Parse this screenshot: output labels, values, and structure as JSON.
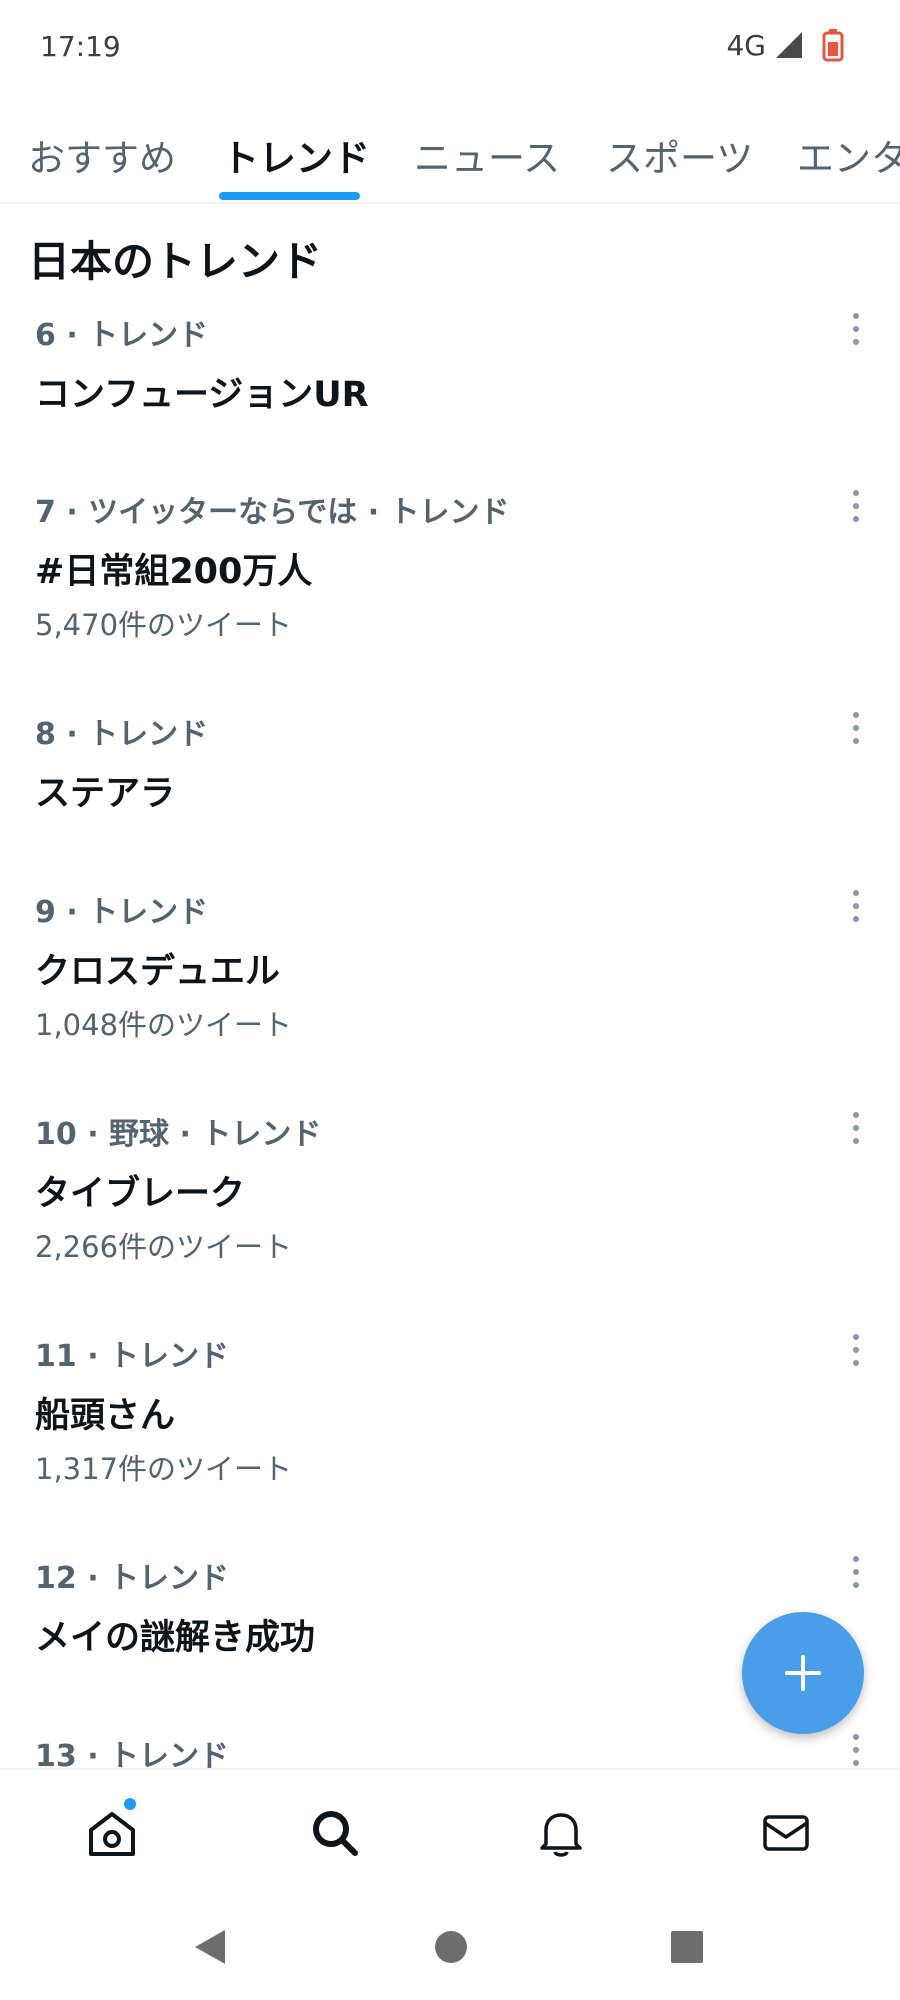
{
  "status_bar": {
    "time": "17:19",
    "network": "4G",
    "icons": [
      "signal-icon",
      "battery-icon"
    ],
    "battery_color": "#e8553d"
  },
  "tabs": [
    {
      "label": "おすすめ",
      "active": false
    },
    {
      "label": "トレンド",
      "active": true
    },
    {
      "label": "ニュース",
      "active": false
    },
    {
      "label": "スポーツ",
      "active": false
    },
    {
      "label": "エンタ",
      "active": false
    }
  ],
  "section": {
    "title": "日本のトレンド"
  },
  "trends": [
    {
      "meta": "6 · トレンド",
      "name": "コンフュージョンUR",
      "count": ""
    },
    {
      "meta": "7 · ツイッターならでは · トレンド",
      "name": "#日常組200万人",
      "count": "5,470件のツイート"
    },
    {
      "meta": "8 · トレンド",
      "name": "ステアラ",
      "count": ""
    },
    {
      "meta": "9 · トレンド",
      "name": "クロスデュエル",
      "count": "1,048件のツイート"
    },
    {
      "meta": "10 · 野球 · トレンド",
      "name": "タイブレーク",
      "count": "2,266件のツイート"
    },
    {
      "meta": "11 · トレンド",
      "name": "船頭さん",
      "count": "1,317件のツイート"
    },
    {
      "meta": "12 · トレンド",
      "name": "メイの謎解き成功",
      "count": ""
    },
    {
      "meta": "13 · トレンド",
      "name": "",
      "count": ""
    }
  ],
  "fab": {
    "icon": "plus-icon",
    "color": "#4a9de8"
  },
  "bottom_nav": [
    {
      "icon": "home-icon",
      "has_badge": true
    },
    {
      "icon": "search-icon",
      "active": true
    },
    {
      "icon": "bell-icon"
    },
    {
      "icon": "mail-icon"
    }
  ],
  "system_nav": [
    "back-icon",
    "home-circle-icon",
    "recents-icon"
  ],
  "colors": {
    "accent": "#1d9bf0",
    "secondary_text": "#536471",
    "primary_text": "#0f1419"
  }
}
